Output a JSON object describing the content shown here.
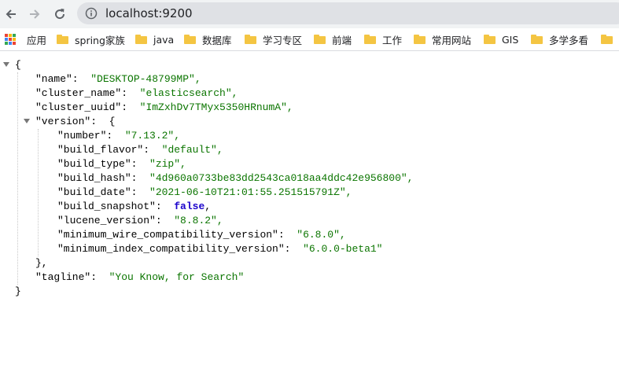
{
  "browser": {
    "url": "localhost:9200",
    "bookmarks": [
      {
        "label": "应用"
      },
      {
        "label": "spring家族"
      },
      {
        "label": "java"
      },
      {
        "label": "数据库"
      },
      {
        "label": "学习专区"
      },
      {
        "label": "前端"
      },
      {
        "label": "工作"
      },
      {
        "label": "常用网站"
      },
      {
        "label": "GIS"
      },
      {
        "label": "多学多看"
      }
    ]
  },
  "json": {
    "open_brace": "{",
    "close_brace": "}",
    "name_key": "\"name\":",
    "name_val": "\"DESKTOP-48799MP\",",
    "cluster_name_key": "\"cluster_name\":",
    "cluster_name_val": "\"elasticsearch\",",
    "cluster_uuid_key": "\"cluster_uuid\":",
    "cluster_uuid_val": "\"ImZxhDv7TMyx5350HRnumA\",",
    "version_key": "\"version\":",
    "version_open": "{",
    "number_key": "\"number\":",
    "number_val": "\"7.13.2\",",
    "build_flavor_key": "\"build_flavor\":",
    "build_flavor_val": "\"default\",",
    "build_type_key": "\"build_type\":",
    "build_type_val": "\"zip\",",
    "build_hash_key": "\"build_hash\":",
    "build_hash_val": "\"4d960a0733be83dd2543ca018aa4ddc42e956800\",",
    "build_date_key": "\"build_date\":",
    "build_date_val": "\"2021-06-10T21:01:55.251515791Z\",",
    "build_snapshot_key": "\"build_snapshot\":",
    "build_snapshot_val": "false",
    "build_snapshot_comma": ",",
    "lucene_version_key": "\"lucene_version\":",
    "lucene_version_val": "\"8.8.2\",",
    "min_wire_key": "\"minimum_wire_compatibility_version\":",
    "min_wire_val": "\"6.8.0\",",
    "min_index_key": "\"minimum_index_compatibility_version\":",
    "min_index_val": "\"6.0.0-beta1\"",
    "version_close": "},",
    "tagline_key": "\"tagline\":",
    "tagline_val": "\"You Know, for Search\""
  }
}
